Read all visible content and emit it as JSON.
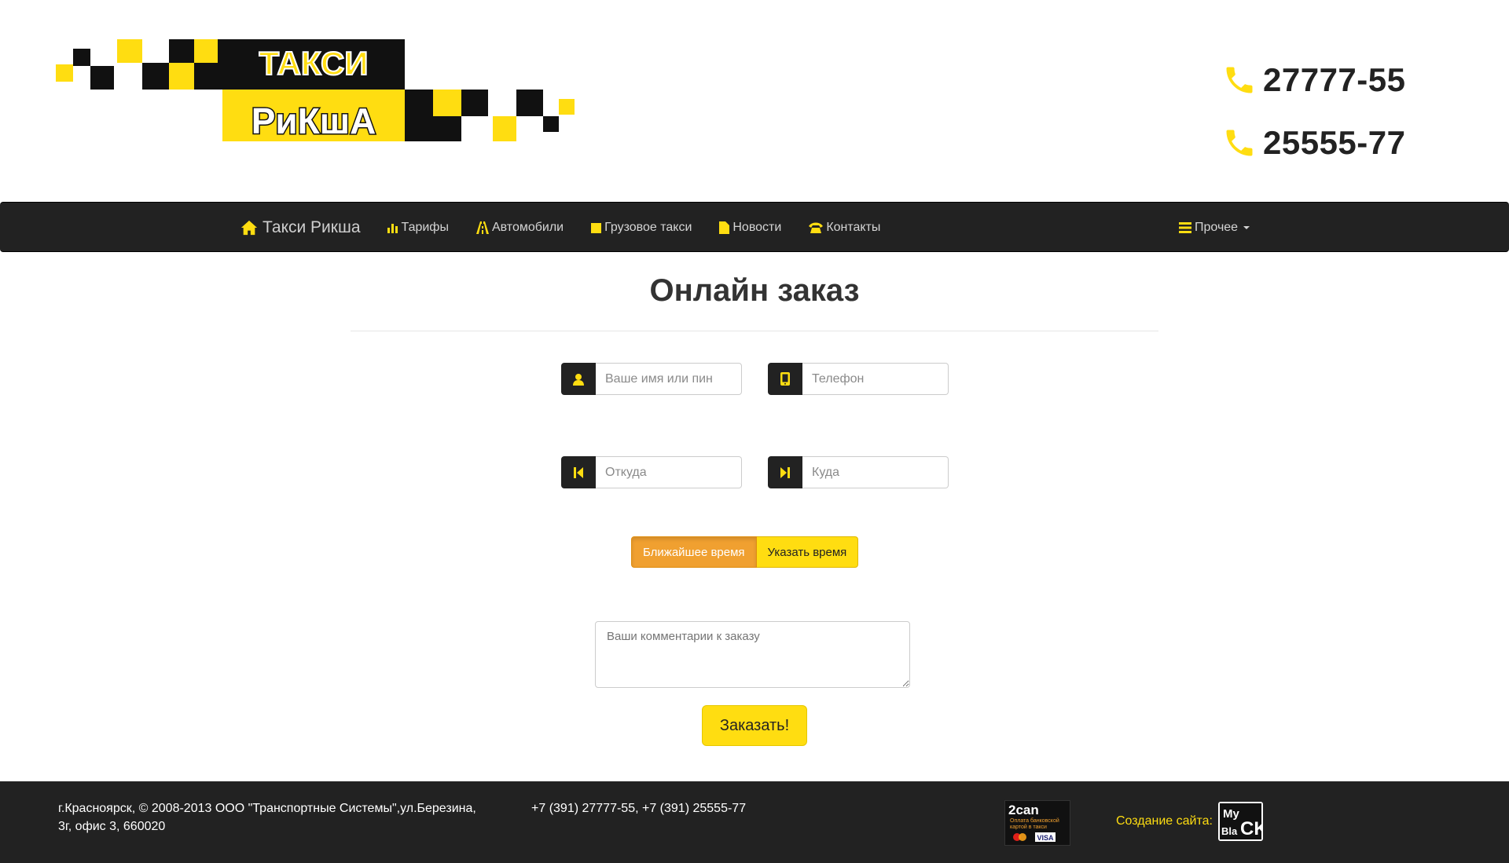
{
  "header": {
    "logo": {
      "line1": "ТАКСИ",
      "line2": "РиКшА"
    },
    "phones": [
      "27777-55",
      "25555-77"
    ]
  },
  "nav": {
    "brand": "Такси Рикша",
    "items": [
      {
        "label": "Тарифы",
        "icon": "bar-chart-icon"
      },
      {
        "label": "Автомобили",
        "icon": "road-icon"
      },
      {
        "label": "Грузовое такси",
        "icon": "stop-icon"
      },
      {
        "label": "Новости",
        "icon": "file-icon"
      },
      {
        "label": "Контакты",
        "icon": "phone-alt-icon"
      }
    ],
    "more": "Прочее"
  },
  "main": {
    "title": "Онлайн заказ",
    "fields": {
      "name_placeholder": "Ваше имя или пин",
      "phone_placeholder": "Телефон",
      "from_placeholder": "Откуда",
      "to_placeholder": "Куда"
    },
    "time_options": {
      "nearest": "Ближайшее время",
      "specify": "Указать время",
      "selected": "Ближайшее время"
    },
    "comment_placeholder": "Ваши комментарии к заказу",
    "submit_label": "Заказать!"
  },
  "footer": {
    "address_line1": "г.Красноярск, © 2008-2013 ООО \"Транспортные Системы\",ул.Березина,",
    "address_line2": "3г, офис 3, 660020",
    "phones": "+7 (391) 27777-55, +7 (391) 25555-77",
    "payment_badge": {
      "title": "2can",
      "text": "Оплата банковской картой в такси",
      "cards": [
        "MasterCard",
        "VISA"
      ]
    },
    "credit_label": "Создание сайта:",
    "credit_logo": [
      "My",
      "Bla",
      "CK"
    ]
  },
  "colors": {
    "accent": "#ffdd11",
    "active_orange": "#f0a030",
    "dark": "#222222"
  }
}
